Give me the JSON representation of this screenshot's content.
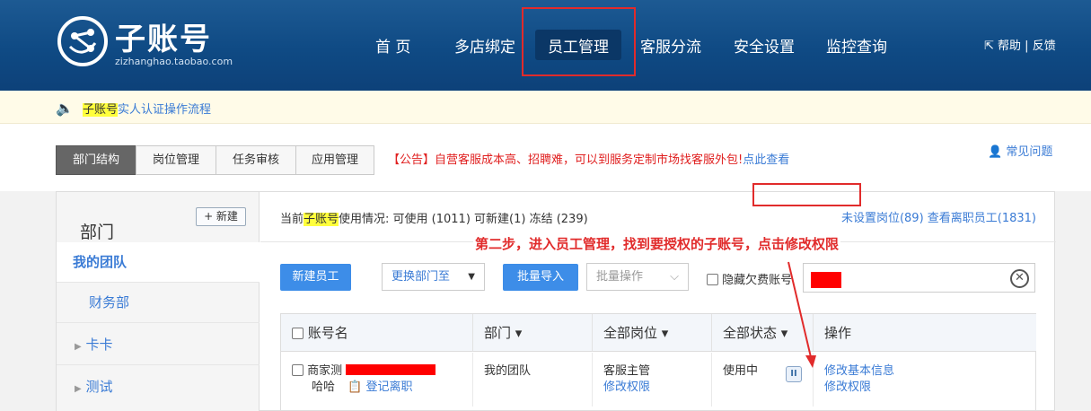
{
  "header": {
    "logo_title": "子账号",
    "logo_sub": "zizhanghao.taobao.com",
    "nav": [
      "首 页",
      "多店绑定",
      "员工管理",
      "客服分流",
      "安全设置",
      "监控查询"
    ],
    "active_nav": "员工管理",
    "help": "帮助 | 反馈"
  },
  "notice": {
    "icon": "speaker-icon",
    "highlight": "子账号",
    "text": "实人认证操作流程"
  },
  "tabs": [
    "部门结构",
    "岗位管理",
    "任务审核",
    "应用管理"
  ],
  "announcement": {
    "text": "【公告】自营客服成本高、招聘难，可以到服务定制市场找客服外包!",
    "link": "点此查看"
  },
  "faq": "常见问题",
  "sidebar": {
    "title": "部门",
    "new_button": "+ 新建",
    "items": [
      {
        "label": "我的团队"
      },
      {
        "label": "财务部"
      },
      {
        "label": "卡卡"
      },
      {
        "label": "测试"
      }
    ]
  },
  "usage": {
    "prefix": "当前",
    "highlight": "子账号",
    "text": "使用情况:  可使用 (1011)    可新建(1)    冻结 (239)"
  },
  "top_links": "未设置岗位(89) 查看离职员工(1831)",
  "step_note": "第二步，进入员工管理，找到要授权的子账号，点击修改权限",
  "toolbar": {
    "new_employee": "新建员工",
    "change_dept": "更换部门至",
    "batch_import": "批量导入",
    "batch_ops": "批量操作",
    "hide_owing": "隐藏欠费账号"
  },
  "table": {
    "headers": [
      "账号名",
      "部门 ▾",
      "全部岗位 ▾",
      "全部状态 ▾",
      "操作"
    ],
    "row": {
      "account_prefix": "商家测",
      "account_second_line": "哈哈",
      "leave_link": "登记离职",
      "department": "我的团队",
      "position": "客服主管",
      "position_link": "修改权限",
      "status": "使用中",
      "action_1": "修改基本信息",
      "action_2": "修改权限"
    }
  },
  "colors": {
    "header_blue": "#0f4a84",
    "accent_blue": "#3d8de8",
    "link_blue": "#3a7bd5",
    "annotation_red": "#e12b2b",
    "highlight_yellow": "#ffff3c"
  }
}
